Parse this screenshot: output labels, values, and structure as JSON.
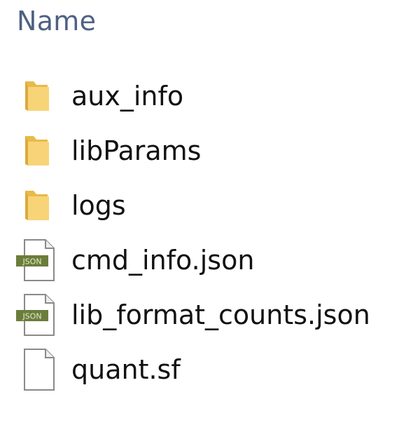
{
  "header": {
    "name_column": "Name"
  },
  "files": [
    {
      "name": "aux_info",
      "icon": "folder-icon"
    },
    {
      "name": "libParams",
      "icon": "folder-icon"
    },
    {
      "name": "logs",
      "icon": "folder-icon"
    },
    {
      "name": "cmd_info.json",
      "icon": "json-file-icon",
      "icon_text": "JSON"
    },
    {
      "name": "lib_format_counts.json",
      "icon": "json-file-icon",
      "icon_text": "JSON"
    },
    {
      "name": "quant.sf",
      "icon": "blank-file-icon"
    }
  ],
  "colors": {
    "header_text": "#4d6182",
    "folder": "#f5cf6a",
    "json_badge": "#6b7d3c"
  }
}
